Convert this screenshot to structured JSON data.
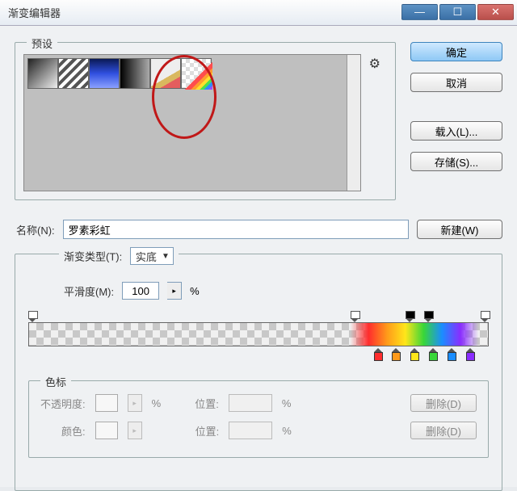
{
  "window": {
    "title": "渐变编辑器",
    "min": "—",
    "max": "☐",
    "close": "✕"
  },
  "presets": {
    "legend": "预设",
    "gear": "⚙"
  },
  "buttons": {
    "ok": "确定",
    "cancel": "取消",
    "load": "载入(L)...",
    "save": "存储(S)...",
    "new": "新建(W)"
  },
  "name": {
    "label": "名称(N):",
    "value": "罗素彩虹"
  },
  "type": {
    "label": "渐变类型(T):",
    "value": "实底",
    "smooth_label": "平滑度(M):",
    "smooth_value": "100",
    "smooth_unit": "%",
    "step": "▸"
  },
  "stops": {
    "legend": "色标",
    "opacity_label": "不透明度:",
    "opacity_unit": "%",
    "position_label": "位置:",
    "position_unit": "%",
    "delete_label": "删除(D)",
    "color_label": "颜色:",
    "color_step": "▸"
  },
  "chart_data": {
    "type": "table",
    "title": "Gradient color stops (approximate %)",
    "opacity_stops": [
      {
        "position": 0,
        "opacity": 0
      },
      {
        "position": 70,
        "opacity": 0
      },
      {
        "position": 82,
        "opacity": 100
      },
      {
        "position": 86,
        "opacity": 100
      },
      {
        "position": 100,
        "opacity": 0
      }
    ],
    "color_stops": [
      {
        "position": 75,
        "color": "#ff2d2d"
      },
      {
        "position": 79,
        "color": "#ff9a1a"
      },
      {
        "position": 83,
        "color": "#ffe61a"
      },
      {
        "position": 87,
        "color": "#38d638"
      },
      {
        "position": 91,
        "color": "#1a8dff"
      },
      {
        "position": 95,
        "color": "#8a2dff"
      }
    ]
  }
}
